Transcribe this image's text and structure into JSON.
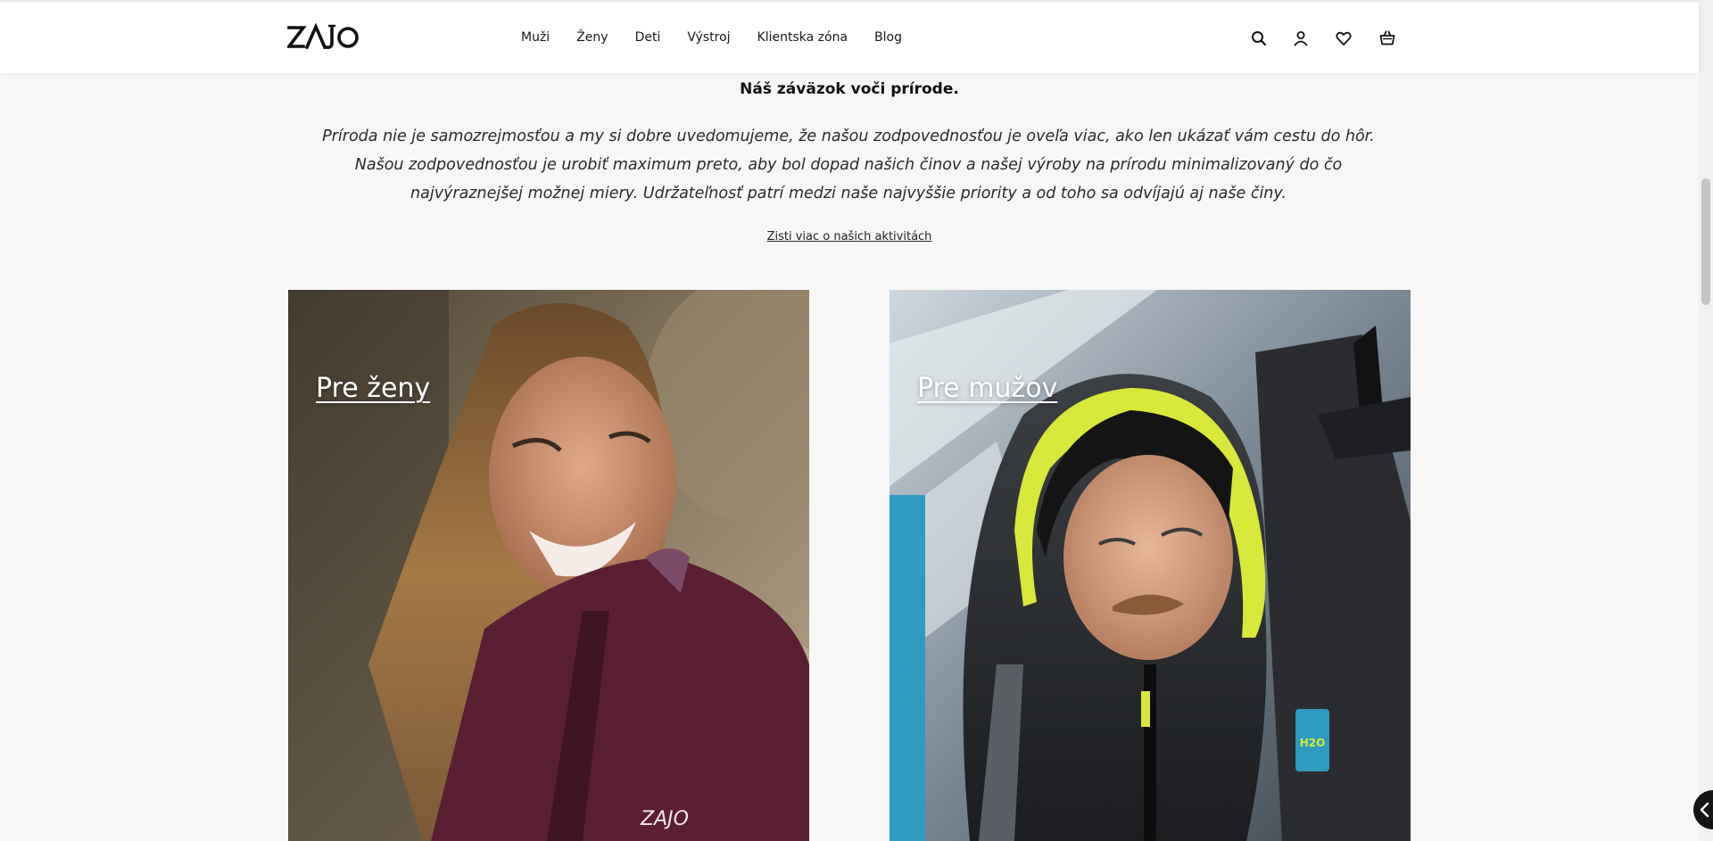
{
  "header": {
    "logo_text": "ZAJO",
    "nav": [
      "Muži",
      "Ženy",
      "Deti",
      "Výstroj",
      "Klientska zóna",
      "Blog"
    ],
    "icons": [
      "search-icon",
      "account-icon",
      "wishlist-heart-icon",
      "cart-basket-icon"
    ]
  },
  "commitment": {
    "title": "Náš záväzok voči prírode.",
    "text": "Príroda nie je samozrejmosťou a my si dobre uvedomujeme, že našou zodpovednosťou je oveľa viac, ako len ukázať vám cestu do hôr. Našou zodpovednosťou je urobiť maximum preto, aby bol dopad našich činov a našej výroby na prírodu minimalizovaný do čo najvýraznejšej možnej miery. Udržateľnosť patrí medzi naše najvyššie priority a od toho sa odvíjajú aj naše činy.",
    "link": "Zisti viac o našich aktivitách"
  },
  "cards": {
    "women": {
      "label": "Pre ženy",
      "jacket_brand": "ZAJO"
    },
    "men": {
      "label": "Pre mužov",
      "backpack_badge": "H2O"
    }
  },
  "colors": {
    "page_background": "#f7f7f7",
    "header_background": "#ffffff",
    "women_jacket": "#5a1f33",
    "men_hood_trim": "#d8e83a"
  }
}
